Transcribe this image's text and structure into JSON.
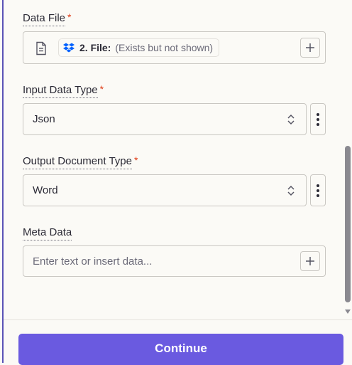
{
  "fields": {
    "data_file": {
      "label": "Data File",
      "required_mark": "*",
      "pill_step": "2. File:",
      "pill_note": "(Exists but not shown)",
      "icon": "file-icon",
      "pill_icon": "dropbox-icon"
    },
    "input_data_type": {
      "label": "Input Data Type",
      "required_mark": "*",
      "value": "Json"
    },
    "output_document_type": {
      "label": "Output Document Type",
      "required_mark": "*",
      "value": "Word"
    },
    "meta_data": {
      "label": "Meta Data",
      "placeholder": "Enter text or insert data..."
    }
  },
  "footer": {
    "continue_label": "Continue"
  },
  "colors": {
    "accent": "#6a5ae0",
    "required": "#e0401b",
    "dropbox": "#0061fe"
  }
}
